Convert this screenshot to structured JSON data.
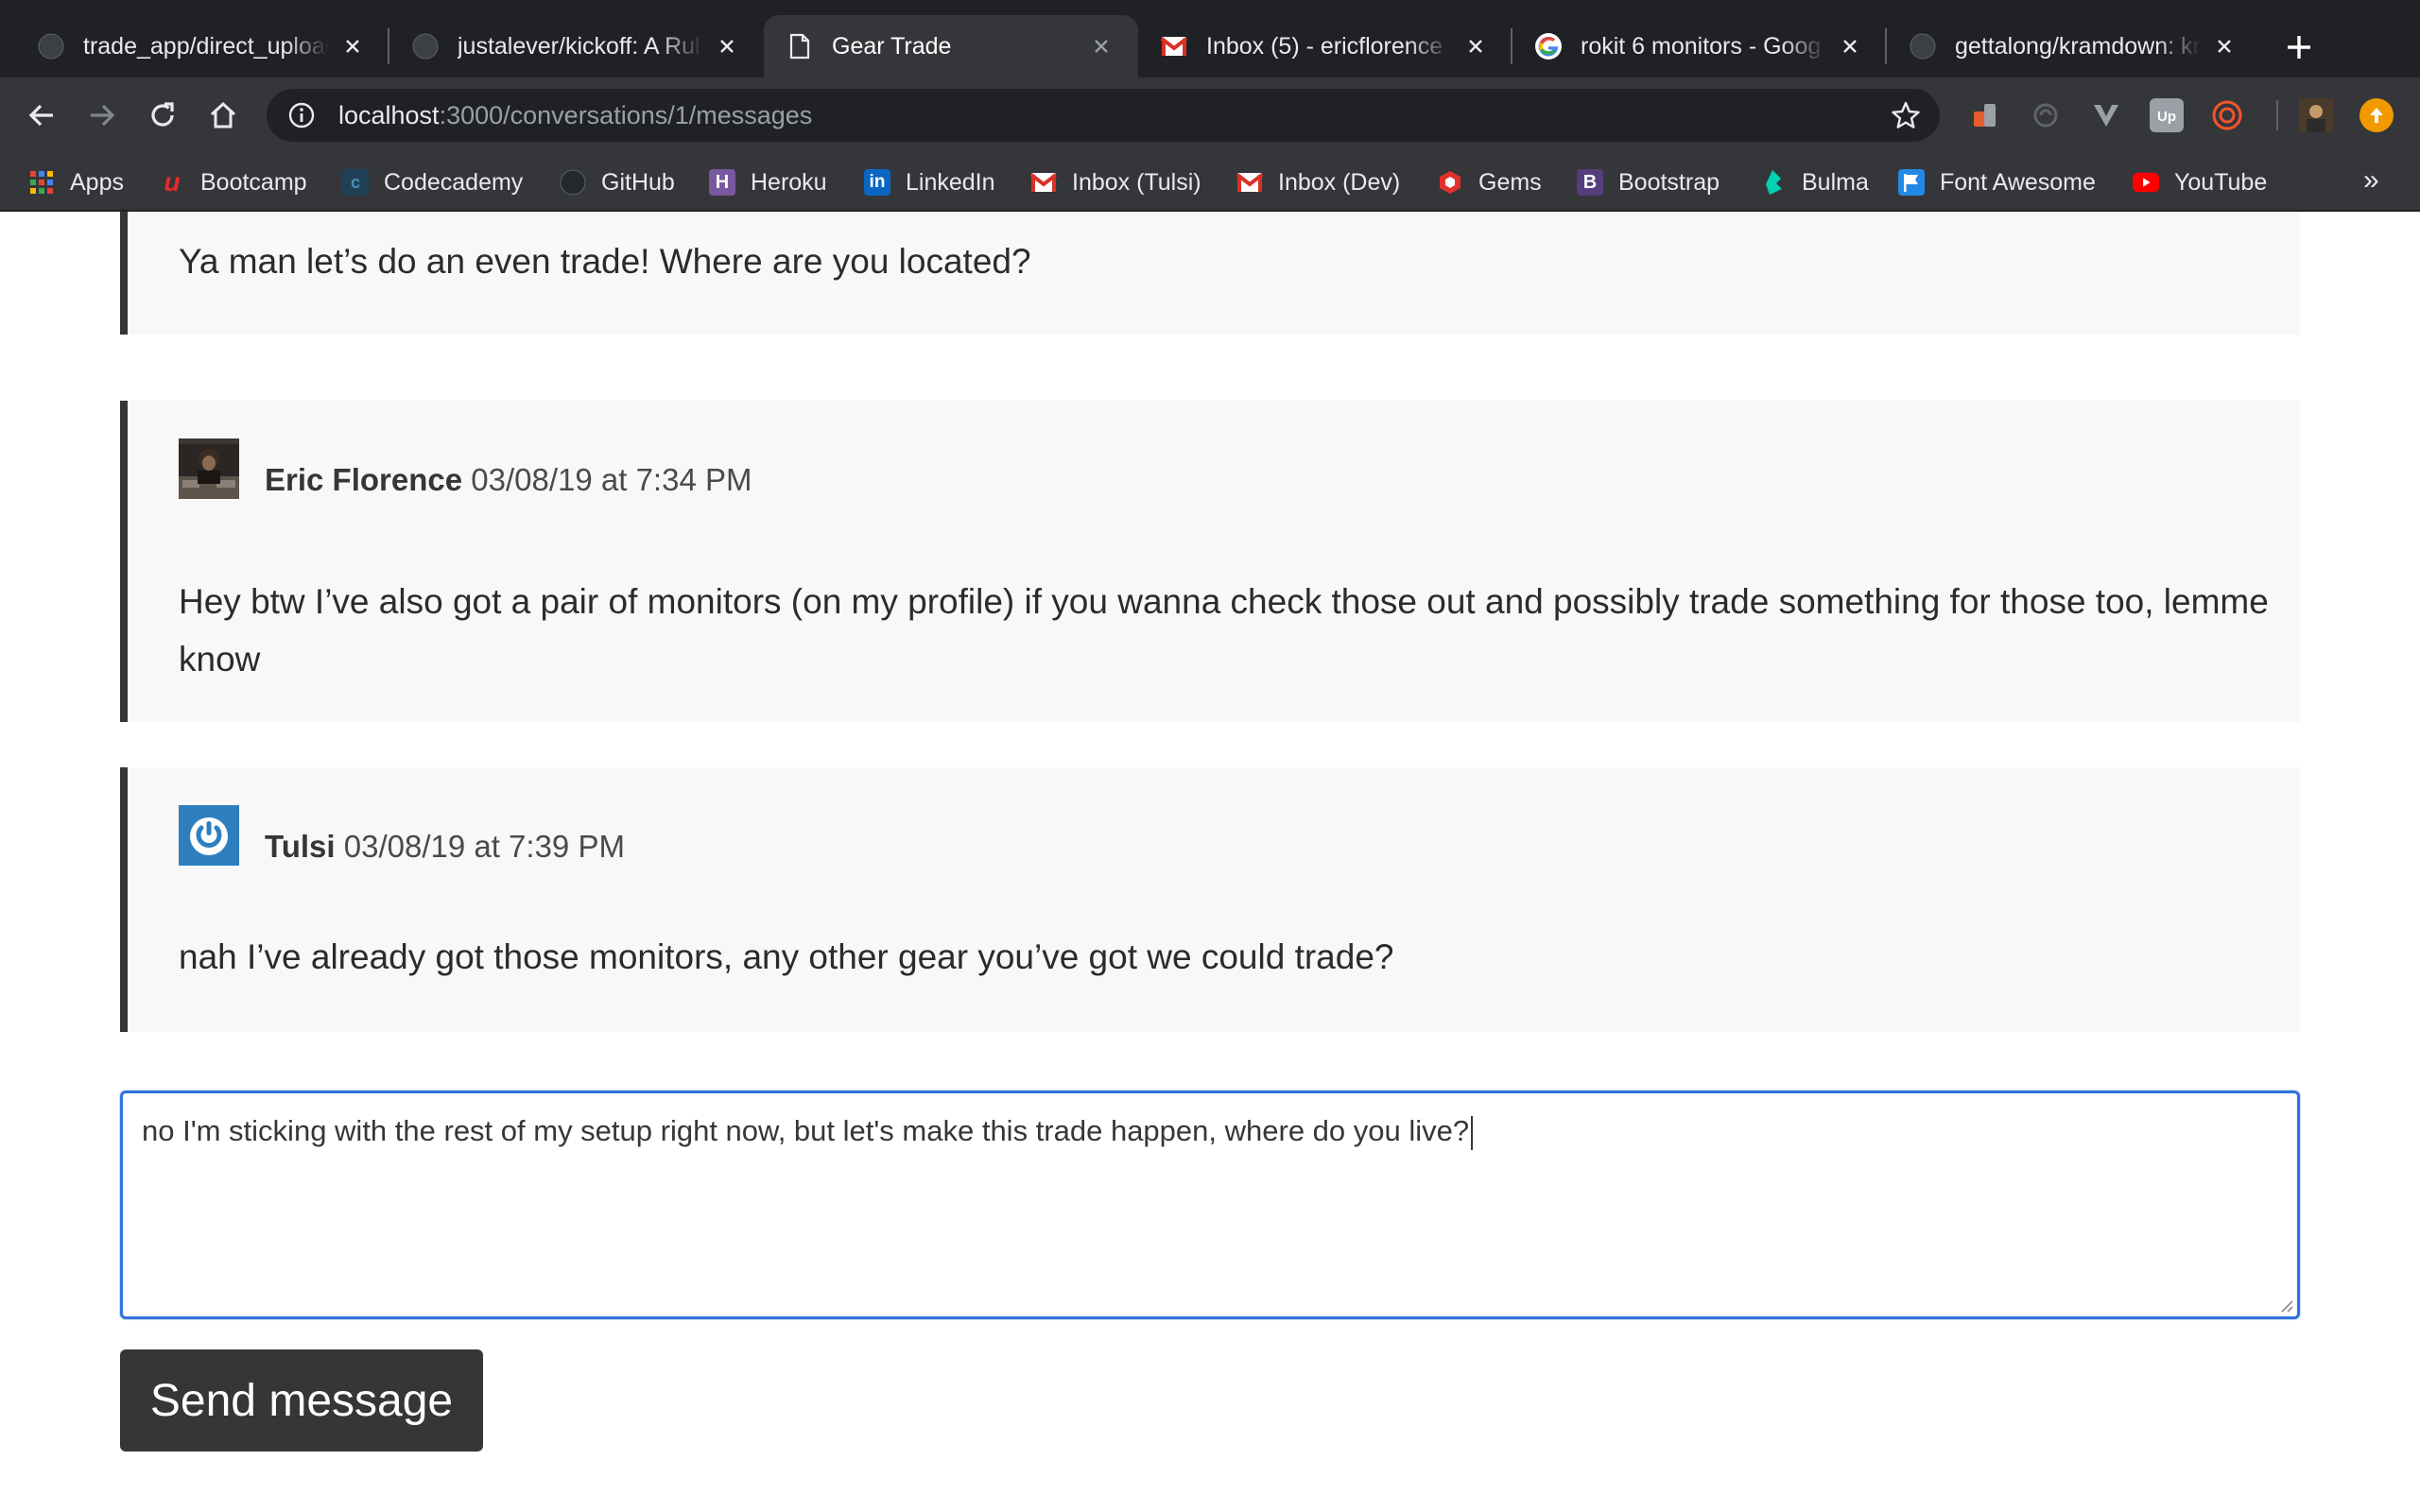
{
  "browser": {
    "tabs": [
      {
        "title": "trade_app/direct_uploac",
        "favicon": "github-icon",
        "active": false
      },
      {
        "title": "justalever/kickoff: A Rul",
        "favicon": "github-icon",
        "active": false
      },
      {
        "title": "Gear Trade",
        "favicon": "page-icon",
        "active": true
      },
      {
        "title": "Inbox (5) - ericflorence",
        "favicon": "gmail-icon",
        "active": false
      },
      {
        "title": "rokit 6 monitors - Goog",
        "favicon": "google-icon",
        "active": false
      },
      {
        "title": "gettalong/kramdown: kr",
        "favicon": "github-icon",
        "active": false
      }
    ],
    "url_host": "localhost",
    "url_path": ":3000/conversations/1/messages",
    "bookmarks": [
      {
        "label": "Apps",
        "icon": "apps-grid-icon",
        "color": "#ea4335"
      },
      {
        "label": "Bootcamp",
        "icon": "u-logo-icon",
        "color": "#e52b2b"
      },
      {
        "label": "Codecademy",
        "icon": "codecademy-icon",
        "color": "#1f4056"
      },
      {
        "label": "GitHub",
        "icon": "github-icon",
        "color": "#24292e"
      },
      {
        "label": "Heroku",
        "icon": "heroku-icon",
        "color": "#79589f"
      },
      {
        "label": "LinkedIn",
        "icon": "linkedin-icon",
        "color": "#0a66c2"
      },
      {
        "label": "Inbox (Tulsi)",
        "icon": "gmail-icon",
        "color": "#d93025"
      },
      {
        "label": "Inbox (Dev)",
        "icon": "gmail-icon",
        "color": "#d93025"
      },
      {
        "label": "Gems",
        "icon": "ruby-gem-icon",
        "color": "#e0312b"
      },
      {
        "label": "Bootstrap",
        "icon": "bootstrap-icon",
        "color": "#563d7c"
      },
      {
        "label": "Bulma",
        "icon": "bulma-icon",
        "color": "#00d1b2"
      },
      {
        "label": "Font Awesome",
        "icon": "flag-icon",
        "color": "#228ae6"
      },
      {
        "label": "YouTube",
        "icon": "youtube-icon",
        "color": "#ff0000"
      }
    ],
    "bookmarks_more": "»"
  },
  "conversation": {
    "messages": [
      {
        "author": "",
        "timestamp": "",
        "avatar": "",
        "body": "Ya man let’s do an even trade! Where are you located?"
      },
      {
        "author": "Eric Florence",
        "timestamp": "03/08/19 at 7:34 PM",
        "avatar": "user-photo-avatar",
        "body": "Hey btw I’ve also got a pair of monitors (on my profile) if you wanna check those out and possibly trade something for those too, lemme know"
      },
      {
        "author": "Tulsi",
        "timestamp": "03/08/19 at 7:39 PM",
        "avatar": "power-icon-avatar",
        "body": "nah I’ve already got those monitors, any other gear you’ve got we could trade?"
      }
    ],
    "reply_value": "no I'm sticking with the rest of my setup right now, but let's make this trade happen, where do you live?",
    "send_label": "Send message"
  },
  "colors": {
    "accent": "#3273dc",
    "dark": "#363636",
    "message_bg": "#f8f8f8",
    "avatar_blue": "#2f7fbf"
  }
}
